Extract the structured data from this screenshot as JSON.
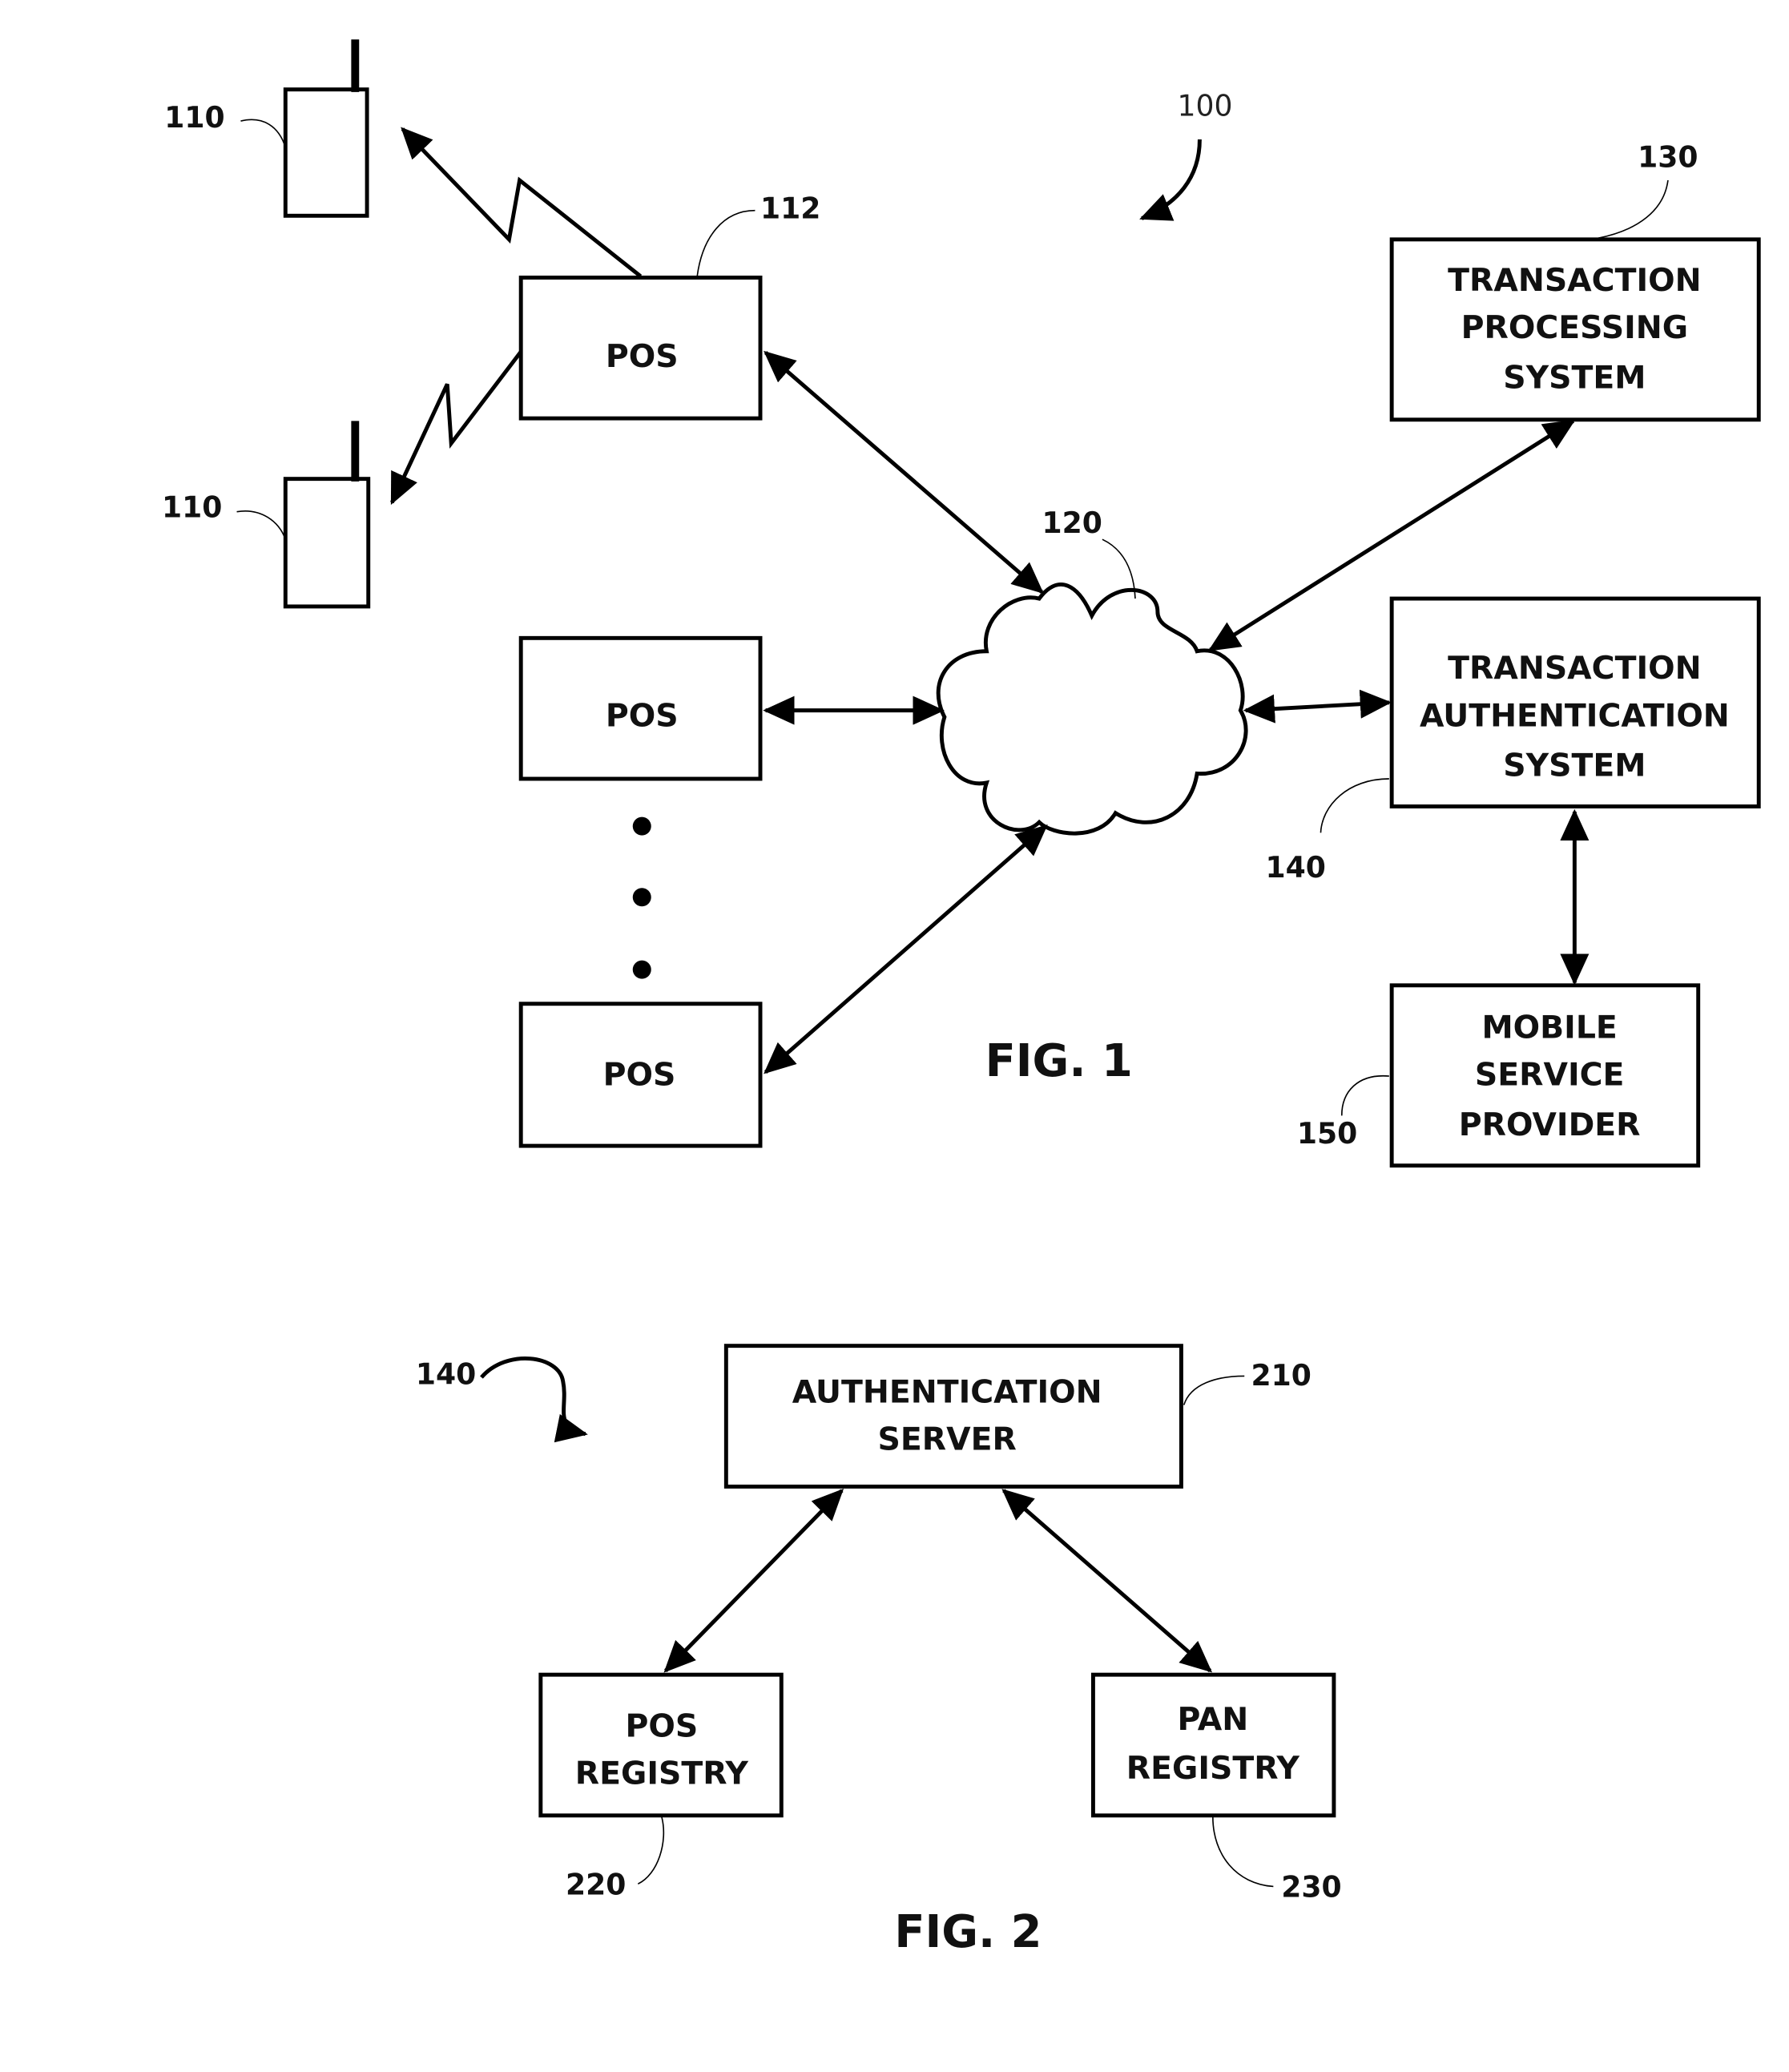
{
  "fig1": {
    "label": "FIG. 1",
    "system_ref": "100",
    "mobile_devices": [
      {
        "ref": "110"
      },
      {
        "ref": "110"
      }
    ],
    "pos_terminals": [
      {
        "label": "POS",
        "ref": "112"
      },
      {
        "label": "POS"
      },
      {
        "label": "POS"
      }
    ],
    "network": {
      "ref": "120"
    },
    "transaction_processing": {
      "lines": [
        "TRANSACTION",
        "PROCESSING",
        "SYSTEM"
      ],
      "ref": "130"
    },
    "transaction_authentication": {
      "lines": [
        "TRANSACTION",
        "AUTHENTICATION",
        "SYSTEM"
      ],
      "ref": "140"
    },
    "mobile_service_provider": {
      "lines": [
        "MOBILE",
        "SERVICE",
        "PROVIDER"
      ],
      "ref": "150"
    }
  },
  "fig2": {
    "label": "FIG. 2",
    "system_ref": "140",
    "authentication_server": {
      "lines": [
        "AUTHENTICATION",
        "SERVER"
      ],
      "ref": "210"
    },
    "pos_registry": {
      "lines": [
        "POS",
        "REGISTRY"
      ],
      "ref": "220"
    },
    "pan_registry": {
      "lines": [
        "PAN",
        "REGISTRY"
      ],
      "ref": "230"
    }
  }
}
